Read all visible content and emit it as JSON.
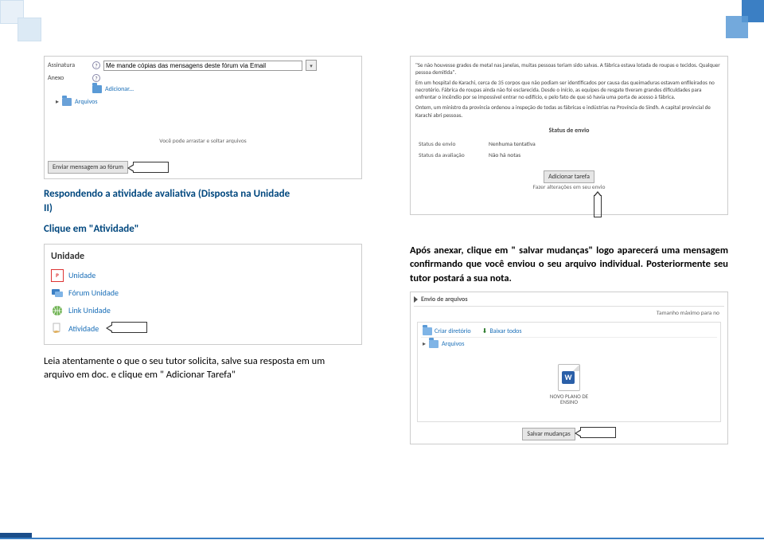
{
  "forum_panel": {
    "assinatura_label": "Assinatura",
    "anexo_label": "Anexo",
    "assinatura_value": "Me mande cópias das mensagens deste fórum via Email",
    "adicionar_label": "Adicionar...",
    "arquivos_label": "Arquivos",
    "note": "Você pode arrastar e soltar arquivos",
    "submit_label": "Enviar mensagem ao fórum"
  },
  "left_caption": {
    "title_line1": "Respondendo a atividade avaliativa (Disposta na Unidade",
    "title_line2": "II)",
    "subtitle": "Clique em \"Atividade\""
  },
  "unidade_panel": {
    "heading": "Unidade",
    "items": [
      {
        "label": "Unidade"
      },
      {
        "label": "Fórum Unidade"
      },
      {
        "label": "Link Unidade"
      },
      {
        "label": "Atividade"
      }
    ]
  },
  "left_body": {
    "line1": "Leia atentamente o que o seu tutor solicita, salve sua resposta em um",
    "line2": "arquivo em doc.  e clique em \" Adicionar Tarefa\""
  },
  "right_top_panel": {
    "quote": "\"Se não houvesse grades de metal nas janelas, muitas pessoas teriam sido salvas. A fábrica estava lotada de roupas e tecidos. Qualquer pessoa demitida\".",
    "p1": "Em um hospital de Karachi, cerca de 35 corpos que não podiam ser identificados por causa das queimaduras estavam enfileirados no necrotério. Fábrica de roupas ainda não foi esclarecida. Desde o início, as equipes de resgate tiveram grandes dificuldades para enfrentar o incêndio por se impossível entrar no edifício, e pelo fato de que só havia uma porta de acesso à fábrica.",
    "p2": "Ontem, um ministro da província ordenou a inspeção de todas as fábricas e indústrias na Província de Sindh. A capital provincial de Karachi abri pessoas.",
    "status_header": "Status de envio",
    "status_rows": [
      {
        "label": "Status de envio",
        "value": "Nenhuma tentativa"
      },
      {
        "label": "Status da avaliação",
        "value": "Não há notas"
      }
    ],
    "add_button": "Adicionar tarefa",
    "alt_text": "Fazer alterações em seu envio"
  },
  "right_caption": "Após anexar, clique em \" salvar mudanças\" logo aparecerá uma mensagem confirmando que você enviou o seu arquivo individual. Posteriormente seu tutor postará a sua nota.",
  "envio_panel": {
    "header": "Envio de arquivos",
    "right_note": "Tamanho máximo para no",
    "link_create": "Criar diretório",
    "link_download": "Baixar todos",
    "arquivos_label": "Arquivos",
    "file_name_l1": "NOVO PLANO DE",
    "file_name_l2": "ENSINO",
    "save_label": "Salvar mudanças"
  }
}
